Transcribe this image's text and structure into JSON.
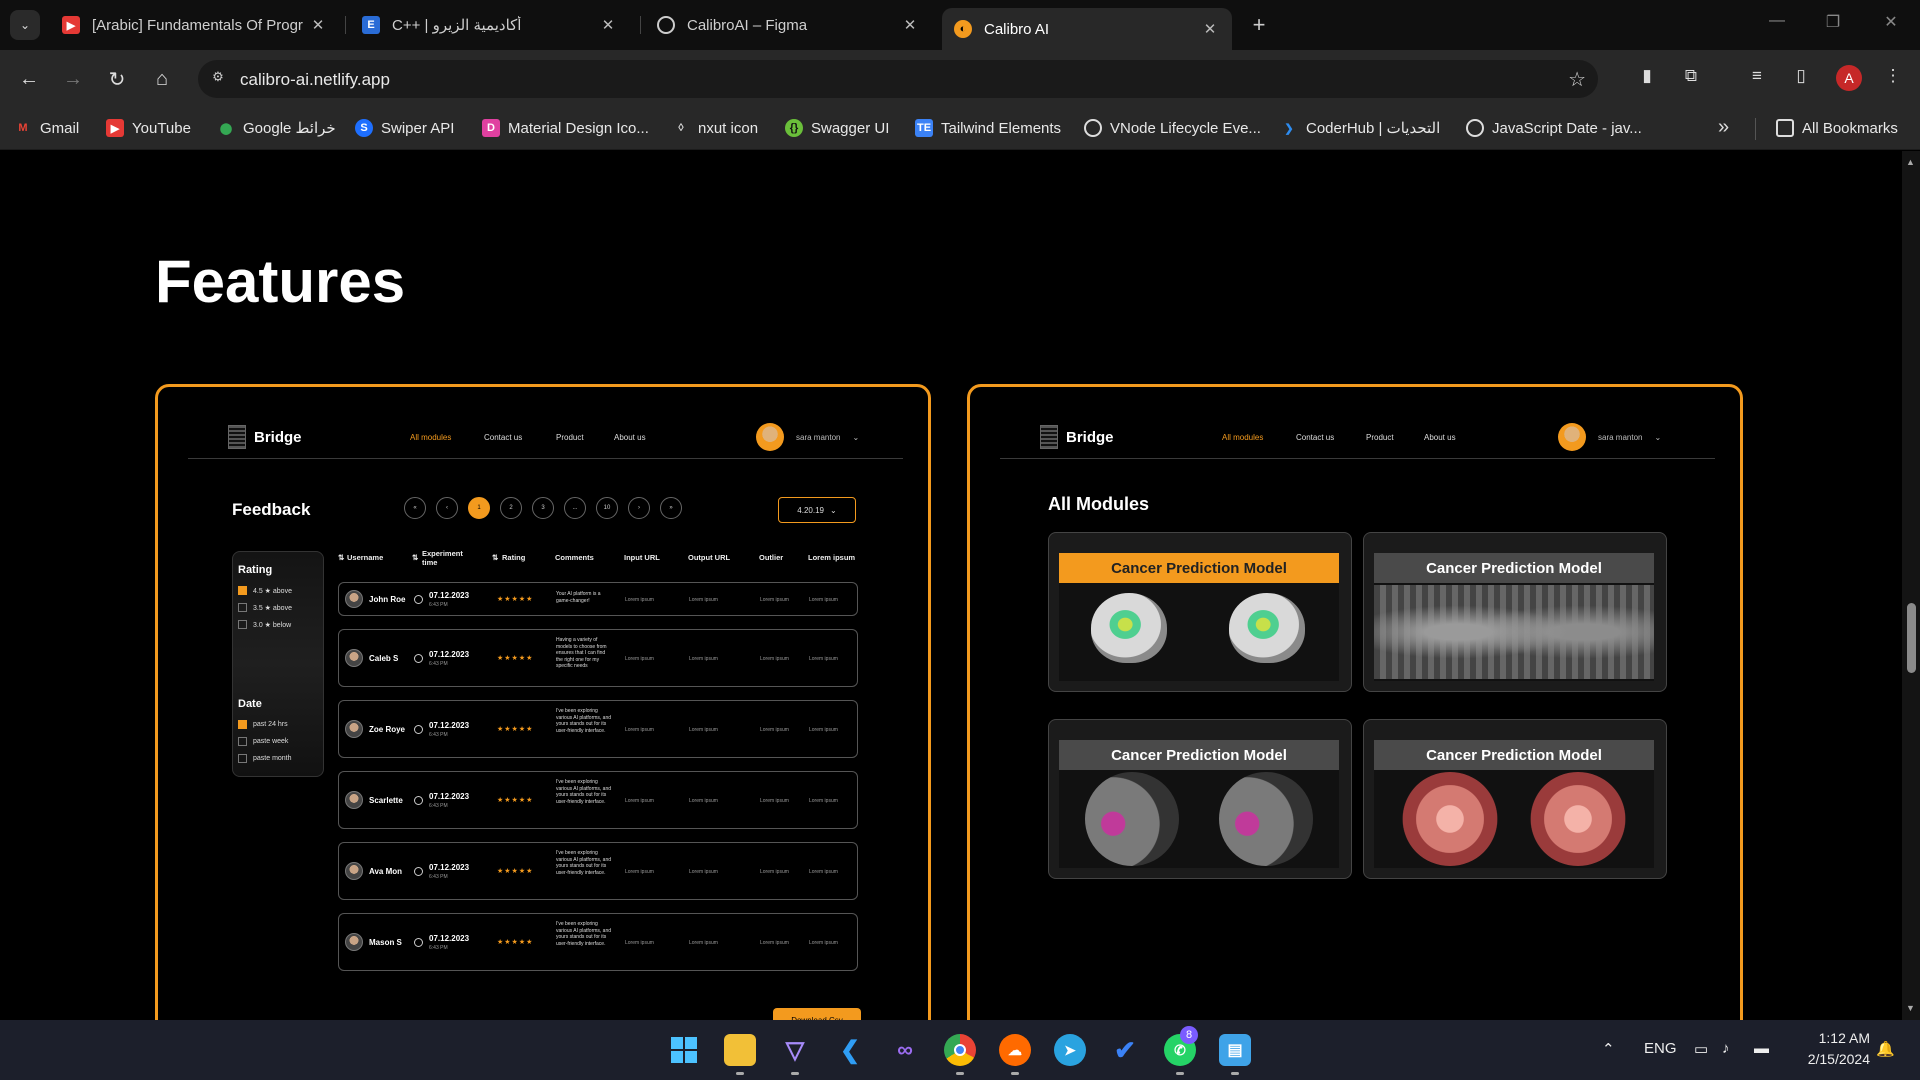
{
  "browser": {
    "tabs": [
      {
        "title": "[Arabic] Fundamentals Of Progr",
        "favicon": "youtube-icon"
      },
      {
        "title": "C++ | أكاديمية الزيرو",
        "favicon": "e-icon"
      },
      {
        "title": "CalibroAI – Figma",
        "favicon": "figma-icon"
      },
      {
        "title": "Calibro AI",
        "favicon": "calibro-icon",
        "active": true
      }
    ],
    "url": "calibro-ai.netlify.app",
    "profile_initial": "A",
    "bookmarks": [
      {
        "label": "Gmail",
        "icon": "gmail-icon"
      },
      {
        "label": "YouTube",
        "icon": "youtube-icon"
      },
      {
        "label": "Google خرائط",
        "icon": "maps-icon"
      },
      {
        "label": "Swiper API",
        "icon": "swiper-icon"
      },
      {
        "label": "Material Design Ico...",
        "icon": "material-icon"
      },
      {
        "label": "nxut icon",
        "icon": "drop-icon"
      },
      {
        "label": "Swagger UI",
        "icon": "swagger-icon"
      },
      {
        "label": "Tailwind Elements",
        "icon": "tailwind-icon"
      },
      {
        "label": "VNode Lifecycle Eve...",
        "icon": "globe-icon"
      },
      {
        "label": "CoderHub | التحديات",
        "icon": "coderhub-icon"
      },
      {
        "label": "JavaScript Date - jav...",
        "icon": "globe-icon"
      }
    ],
    "all_bookmarks": "All Bookmarks"
  },
  "page": {
    "title": "Features",
    "accent": "#f39a1e"
  },
  "feedback_card": {
    "logo": "Bridge",
    "nav": [
      "All modules",
      "Contact us",
      "Product",
      "About us"
    ],
    "user": "sara manton",
    "title": "Feedback",
    "pager": [
      "«",
      "‹",
      "1",
      "2",
      "3",
      "...",
      "10",
      "›",
      "»"
    ],
    "version": "4.20.19",
    "filter": {
      "rating_title": "Rating",
      "rating_options": [
        {
          "label": "4.5 ★ above",
          "checked": true
        },
        {
          "label": "3.5 ★ above",
          "checked": false
        },
        {
          "label": "3.0 ★ below",
          "checked": false
        }
      ],
      "date_title": "Date",
      "date_options": [
        {
          "label": "past 24 hrs",
          "checked": true
        },
        {
          "label": "paste week",
          "checked": false
        },
        {
          "label": "paste month",
          "checked": false
        }
      ]
    },
    "columns": [
      "Username",
      "Experiment time",
      "Rating",
      "Comments",
      "Input URL",
      "Output URL",
      "Outlier",
      "Lorem ipsum"
    ],
    "rows": [
      {
        "name": "John Roe",
        "date": "07.12.2023",
        "time": "6:43 PM",
        "stars": "★★★★★",
        "comment": "Your AI platform is a game-changer!"
      },
      {
        "name": "Caleb S",
        "date": "07.12.2023",
        "time": "6:43 PM",
        "stars": "★★★★★",
        "comment": "Having a variety of models to choose from ensures that I can find the right one for my specific needs"
      },
      {
        "name": "Zoe Roye",
        "date": "07.12.2023",
        "time": "6:43 PM",
        "stars": "★★★★★",
        "comment": "I've been exploring various AI platforms, and yours stands out for its user-friendly interface."
      },
      {
        "name": "Scarlette",
        "date": "07.12.2023",
        "time": "6:43 PM",
        "stars": "★★★★★",
        "comment": "I've been exploring various AI platforms, and yours stands out for its user-friendly interface."
      },
      {
        "name": "Ava Mon",
        "date": "07.12.2023",
        "time": "6:43 PM",
        "stars": "★★★★★",
        "comment": "I've been exploring various AI platforms, and yours stands out for its user-friendly interface."
      },
      {
        "name": "Mason S",
        "date": "07.12.2023",
        "time": "6:43 PM",
        "stars": "★★★★★",
        "comment": "I've been exploring various AI platforms, and yours stands out for its user-friendly interface."
      }
    ],
    "lorem": "Lorem ipsum",
    "download": "Download Csv"
  },
  "modules_card": {
    "logo": "Bridge",
    "nav": [
      "All modules",
      "Contact us",
      "Product",
      "About us"
    ],
    "user": "sara manton",
    "title": "All Modules",
    "modules": [
      {
        "title": "Cancer Prediction Model",
        "style": "orange",
        "image": "brain-mri"
      },
      {
        "title": "Cancer Prediction Model",
        "style": "gray",
        "image": "dental-xray"
      },
      {
        "title": "Cancer Prediction Model",
        "style": "gray",
        "image": "brain-ct"
      },
      {
        "title": "Cancer Prediction Model",
        "style": "gray",
        "image": "endoscopy"
      }
    ]
  },
  "taskbar": {
    "apps": [
      "windows-start-icon",
      "file-explorer-icon",
      "vite-icon",
      "vscode-icon",
      "visual-studio-icon",
      "chrome-icon",
      "soundcloud-icon",
      "telegram-icon",
      "todo-icon",
      "whatsapp-icon",
      "notepad-icon"
    ],
    "whatsapp_badge": "8",
    "language": "ENG",
    "time": "1:12 AM",
    "date": "2/15/2024"
  }
}
